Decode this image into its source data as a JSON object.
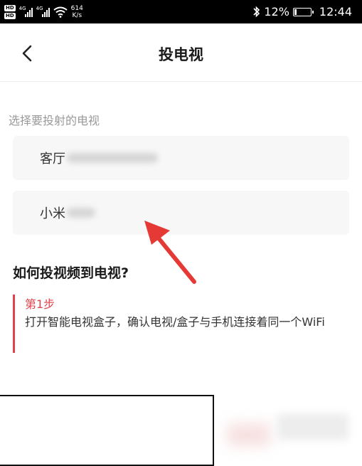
{
  "status_bar": {
    "hd1": "HD",
    "hd2": "HD",
    "net1": "4G",
    "net2": "4G",
    "speed_value": "614",
    "speed_unit": "K/s",
    "battery_percent": "12%",
    "battery_level": 0.12,
    "time": "12:44"
  },
  "header": {
    "title": "投电视"
  },
  "section_label": "选择要投射的电视",
  "devices": [
    {
      "name": "客厅"
    },
    {
      "name": "小米"
    }
  ],
  "howto": {
    "title": "如何投视频到电视?",
    "step_title": "第1步",
    "step_text": "打开智能电视盒子，确认电视/盒子与手机连接着同一个WiFi"
  },
  "colors": {
    "accent": "#e0424d",
    "arrow": "#e53935",
    "card_bg": "#f7f7f7"
  }
}
